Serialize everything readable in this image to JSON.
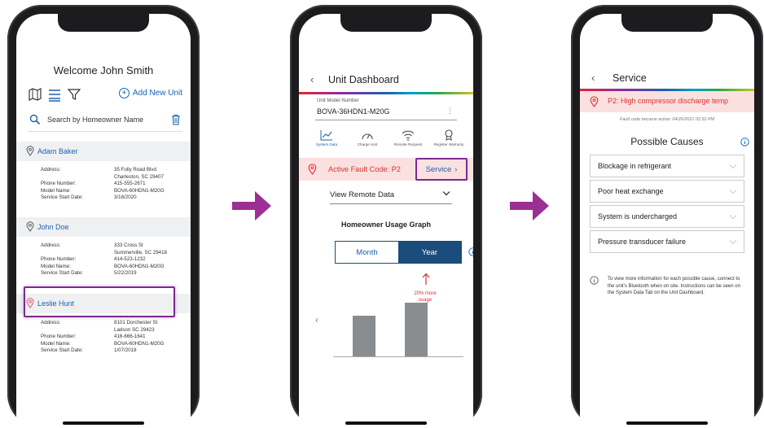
{
  "colors": {
    "accent_purple": "#7b2a8f",
    "link_blue": "#1a62b1",
    "fault_red": "#d9312f",
    "fault_bg": "#fbe0e0",
    "navy": "#1a4c7c"
  },
  "icons": {
    "arrow": "right-arrow-icon",
    "search": "search-icon",
    "map": "map-icon",
    "list": "list-icon",
    "filter": "filter-icon",
    "trash": "trash-icon",
    "pin": "location-pin-icon",
    "back": "chevron-left-icon",
    "info": "info-icon"
  },
  "screen1": {
    "title": "Welcome John Smith",
    "add_new_unit": "Add New Unit",
    "search_placeholder": "Search by Homeowner Name",
    "homeowners": [
      {
        "name": "Adam Baker",
        "address_label": "Address:",
        "address_line1": "35 Folly Road Blvd",
        "address_line2": "Charleston, SC 29407",
        "phone_label": "Phone Number:",
        "phone": "415-555-2671",
        "model_label": "Model Name:",
        "model": "BOVA-60HDN1-M20G",
        "start_label": "Service Start Date:",
        "start": "3/18/2020"
      },
      {
        "name": "John Doe",
        "address_label": "Address:",
        "address_line1": "333 Cross St",
        "address_line2": "Summerville, SC 29418",
        "phone_label": "Phone Number:",
        "phone": "414-523-1232",
        "model_label": "Model Name:",
        "model": "BOVA-60HDN1-M20G",
        "start_label": "Service Start Date:",
        "start": "5/22/2019"
      },
      {
        "name": "Leslie Hunt",
        "address_label": "Address:",
        "address_line1": "8101 Dorchester St",
        "address_line2": "Ladson SC 29423",
        "phone_label": "Phone Number:",
        "phone": "416-666-1641",
        "model_label": "Model Name:",
        "model": "BOVA-60HDN1-M20G",
        "start_label": "Service Start Date:",
        "start": "1/07/2018"
      }
    ]
  },
  "screen2": {
    "title": "Unit Dashboard",
    "model_label": "Unit Model Number",
    "model_value": "BOVA-36HDN1-M20G",
    "tabs": [
      {
        "label": "System Data",
        "icon": "chart-line-icon"
      },
      {
        "label": "Charge Unit",
        "icon": "gauge-icon"
      },
      {
        "label": "Remote Request",
        "icon": "wifi-icon"
      },
      {
        "label": "Register Warranty",
        "icon": "badge-icon"
      }
    ],
    "fault_text": "Active Fault Code: P2",
    "service_label": "Service",
    "select_value": "View Remote Data",
    "graph_title": "Homeowner Usage Graph",
    "toggle_month": "Month",
    "toggle_year": "Year",
    "toggle_selected": "Year",
    "annotation_line1": "20% more",
    "annotation_line2": "usage",
    "usage_bars": [
      0.62,
      0.82
    ]
  },
  "screen3": {
    "title": "Service",
    "fault_text": "P2: High compressor discharge temp",
    "fault_time": "Fault code became active: 04/26/2021 02:52 PM",
    "causes_title": "Possible Causes",
    "causes": [
      "Blockage in refrigerant",
      "Poor heat exchange",
      "System is undercharged",
      "Pressure transducer failure"
    ],
    "note": "To view more information for each possible cause, connect to the unit's Bluetooth when on site. Instructions can be seen on the System Data Tab on the Unit Dashboard."
  }
}
